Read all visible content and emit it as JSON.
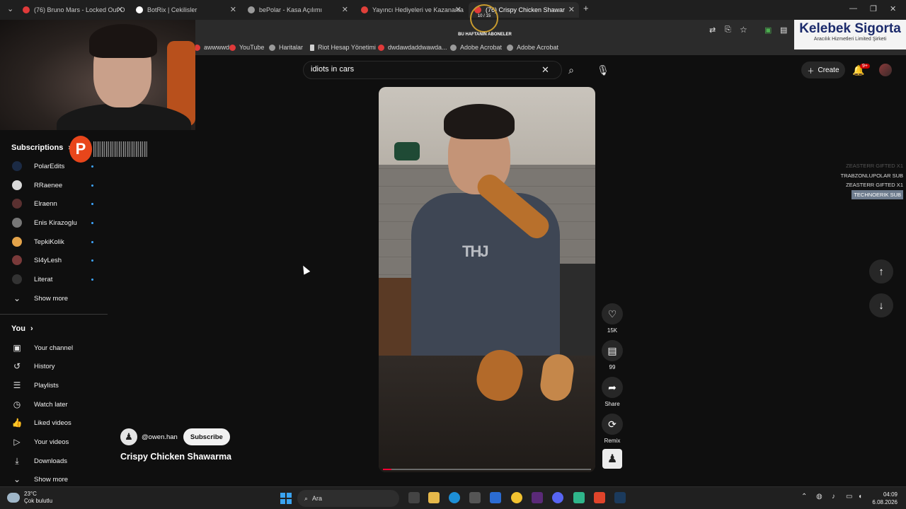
{
  "browser": {
    "tabs": [
      {
        "title": "(76) Bruno Mars - Locked Out O",
        "favicon_color": "#e03a3a",
        "active": false
      },
      {
        "title": "BotRix | Cekilisler",
        "favicon_color": "#ffffff",
        "active": false
      },
      {
        "title": "bePolar - Kasa Açılımı",
        "favicon_color": "#9a9a9a",
        "active": false
      },
      {
        "title": "Yayıncı Hediyeleri ve Kazananla",
        "favicon_color": "#e0403a",
        "active": false
      },
      {
        "title": "(76) Crispy Chicken Shawar",
        "favicon_color": "#e03a3a",
        "active": true
      }
    ],
    "new_tab": "+",
    "bookmarks": [
      {
        "label": "awwwwd",
        "color": "#e03a3a"
      },
      {
        "label": "YouTube",
        "color": "#e03a3a"
      },
      {
        "label": "Haritalar",
        "color": "#9a9a9a"
      },
      {
        "label": "Riot Hesap Yönetimi",
        "color": "#d0d0d0"
      },
      {
        "label": "dwdawdaddwawda...",
        "color": "#e03a3a"
      },
      {
        "label": "Adobe Acrobat",
        "color": "#9a9a9a"
      },
      {
        "label": "Adobe Acrobat",
        "color": "#9a9a9a"
      }
    ]
  },
  "overlay": {
    "weekly_subs_title": "BU HAFTANIN ABONELER",
    "weekly_count": "10 / 15",
    "sponsor_name": "Kelebek Sigorta",
    "sponsor_sub": "Aracılık Hizmetleri Limited Şirketi",
    "gift_feed": [
      {
        "text": "ZEASTERR GIFTED X1",
        "style": "faded"
      },
      {
        "text": "TRABZONLUPOLAR SUB",
        "style": "normal"
      },
      {
        "text": "ZEASTERR GIFTED X1",
        "style": "normal"
      },
      {
        "text": "TECHNOERIK SUB",
        "style": "hl"
      }
    ]
  },
  "masthead": {
    "search_value": "idiots in cars",
    "create_label": "Create",
    "notifications_badge": "9+"
  },
  "sidebar": {
    "subscriptions_label": "Subscriptions",
    "subscriptions": [
      {
        "name": "PolarEdits",
        "color": "#1b2a44"
      },
      {
        "name": "RRaenee",
        "color": "#d9d9d9"
      },
      {
        "name": "Elraenn",
        "color": "#5a3030"
      },
      {
        "name": "Enis Kirazoglu",
        "color": "#777777"
      },
      {
        "name": "TepkiKolik",
        "color": "#e3a34a"
      },
      {
        "name": "Sl4yLesh",
        "color": "#7a3a3a"
      },
      {
        "name": "Literat",
        "color": "#333333"
      }
    ],
    "show_more_label": "Show more",
    "you_label": "You",
    "you_items": [
      {
        "label": "Your channel",
        "icon": "user-square-icon"
      },
      {
        "label": "History",
        "icon": "history-icon"
      },
      {
        "label": "Playlists",
        "icon": "playlist-icon"
      },
      {
        "label": "Watch later",
        "icon": "clock-icon"
      },
      {
        "label": "Liked videos",
        "icon": "thumb-up-icon"
      },
      {
        "label": "Your videos",
        "icon": "video-icon"
      },
      {
        "label": "Downloads",
        "icon": "download-icon"
      }
    ],
    "show_more_label_2": "Show more"
  },
  "short": {
    "channel": "@owen.han",
    "subscribe_label": "Subscribe",
    "title": "Crispy Chicken Shawarma",
    "likes": "15K",
    "comments": "99",
    "share_label": "Share",
    "remix_label": "Remix",
    "progress_fraction": 0.04
  },
  "taskbar": {
    "temperature": "23°C",
    "weather_text": "Çok bulutlu",
    "search_label": "Ara",
    "time": "04:09",
    "date": "6.08.2026"
  }
}
